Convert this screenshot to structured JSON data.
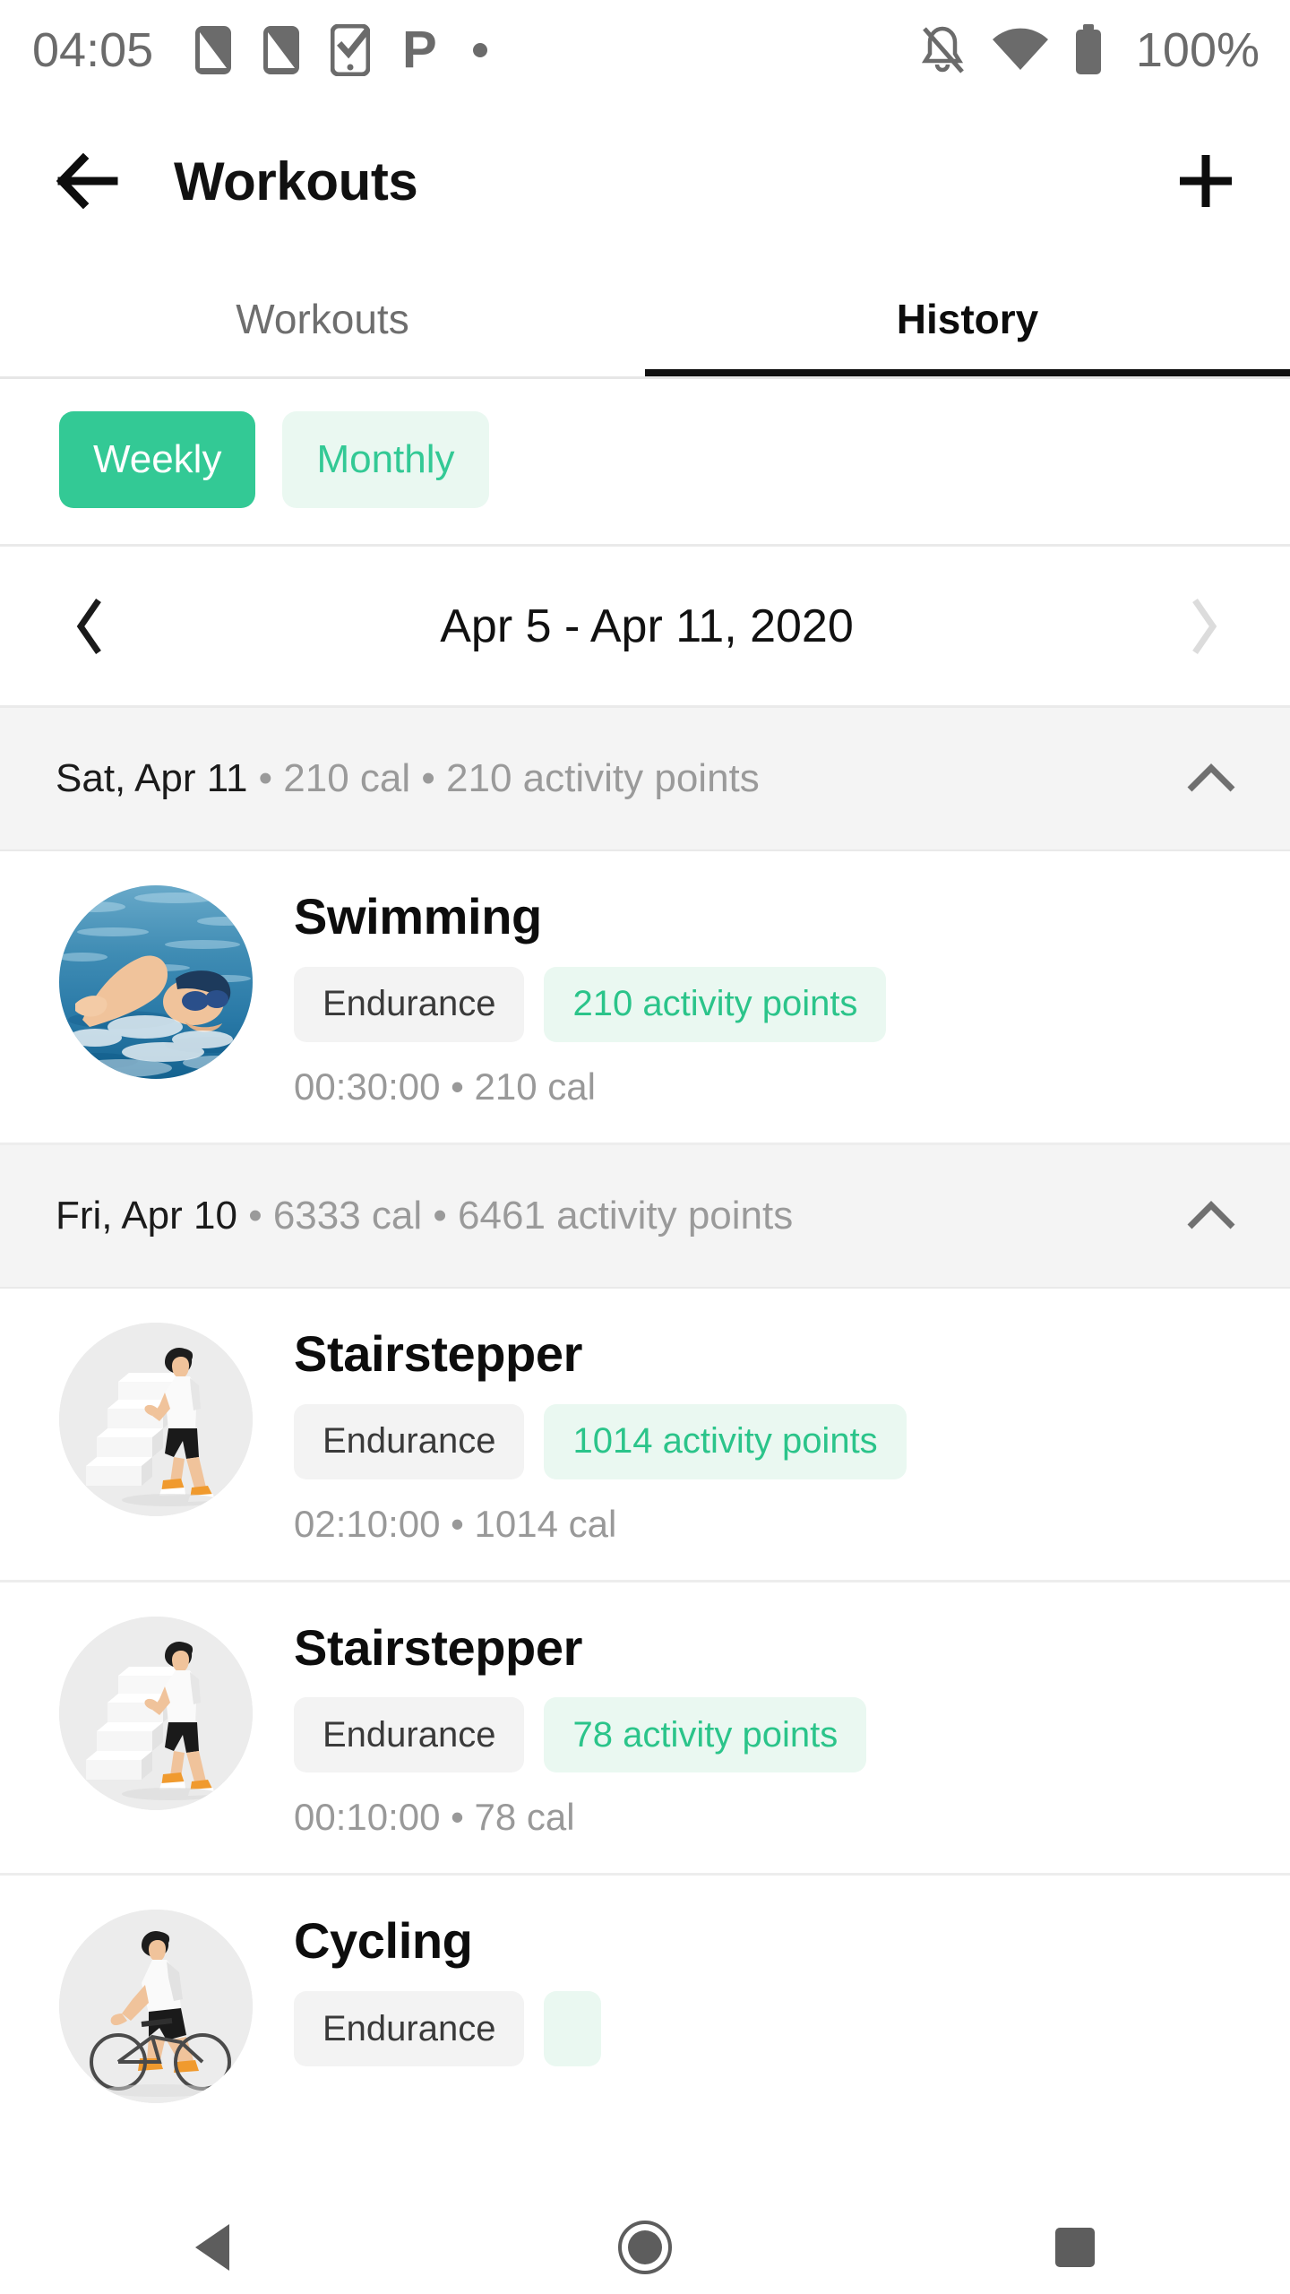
{
  "status_bar": {
    "time": "04:05",
    "left_icons": [
      "sim-card-icon",
      "sim-card-icon",
      "tasks-check-icon",
      "parking-p-icon",
      "dot-icon"
    ],
    "right_icons": [
      "notifications-off-icon",
      "wifi-icon",
      "battery-full-icon"
    ],
    "battery_label": "100%"
  },
  "app_bar": {
    "back_icon": "arrow-left-icon",
    "title": "Workouts",
    "add_icon": "plus-icon"
  },
  "tabs": [
    {
      "label": "Workouts",
      "active": false
    },
    {
      "label": "History",
      "active": true
    }
  ],
  "period_filter": {
    "options": [
      {
        "label": "Weekly",
        "active": true
      },
      {
        "label": "Monthly",
        "active": false
      }
    ]
  },
  "date_nav": {
    "prev_icon": "chevron-left-icon",
    "range_label": "Apr 5 - Apr 11, 2020",
    "next_icon": "chevron-right-icon",
    "prev_enabled": true,
    "next_enabled": false
  },
  "colors": {
    "accent_green": "#33C995",
    "accent_green_soft": "#EAF8F1",
    "points_text": "#2BC48A",
    "chip_gray": "#F3F3F3",
    "header_gray": "#F4F4F4",
    "muted_text": "#9a9a9a"
  },
  "day_groups": [
    {
      "date_label": "Sat, Apr 11",
      "stats_label": " • 210 cal • 210 activity points",
      "collapse_icon": "chevron-up-icon",
      "expanded": true,
      "workouts": [
        {
          "name": "Swimming",
          "image": "swimming-photo",
          "type_chip": "Endurance",
          "points_chip": "210 activity points",
          "meta": "00:30:00 • 210 cal"
        }
      ]
    },
    {
      "date_label": "Fri, Apr 10",
      "stats_label": " • 6333 cal • 6461 activity points",
      "collapse_icon": "chevron-up-icon",
      "expanded": true,
      "workouts": [
        {
          "name": "Stairstepper",
          "image": "stairstepper-illustration",
          "type_chip": "Endurance",
          "points_chip": "1014 activity points",
          "meta": "02:10:00 • 1014 cal"
        },
        {
          "name": "Stairstepper",
          "image": "stairstepper-illustration",
          "type_chip": "Endurance",
          "points_chip": "78 activity points",
          "meta": "00:10:00 • 78 cal"
        },
        {
          "name": "Cycling",
          "image": "cycling-illustration",
          "type_chip": "Endurance",
          "points_chip": "",
          "meta": ""
        }
      ]
    }
  ],
  "nav_bar": {
    "back_icon": "triangle-back-icon",
    "home_icon": "circle-home-icon",
    "recents_icon": "square-recents-icon"
  }
}
